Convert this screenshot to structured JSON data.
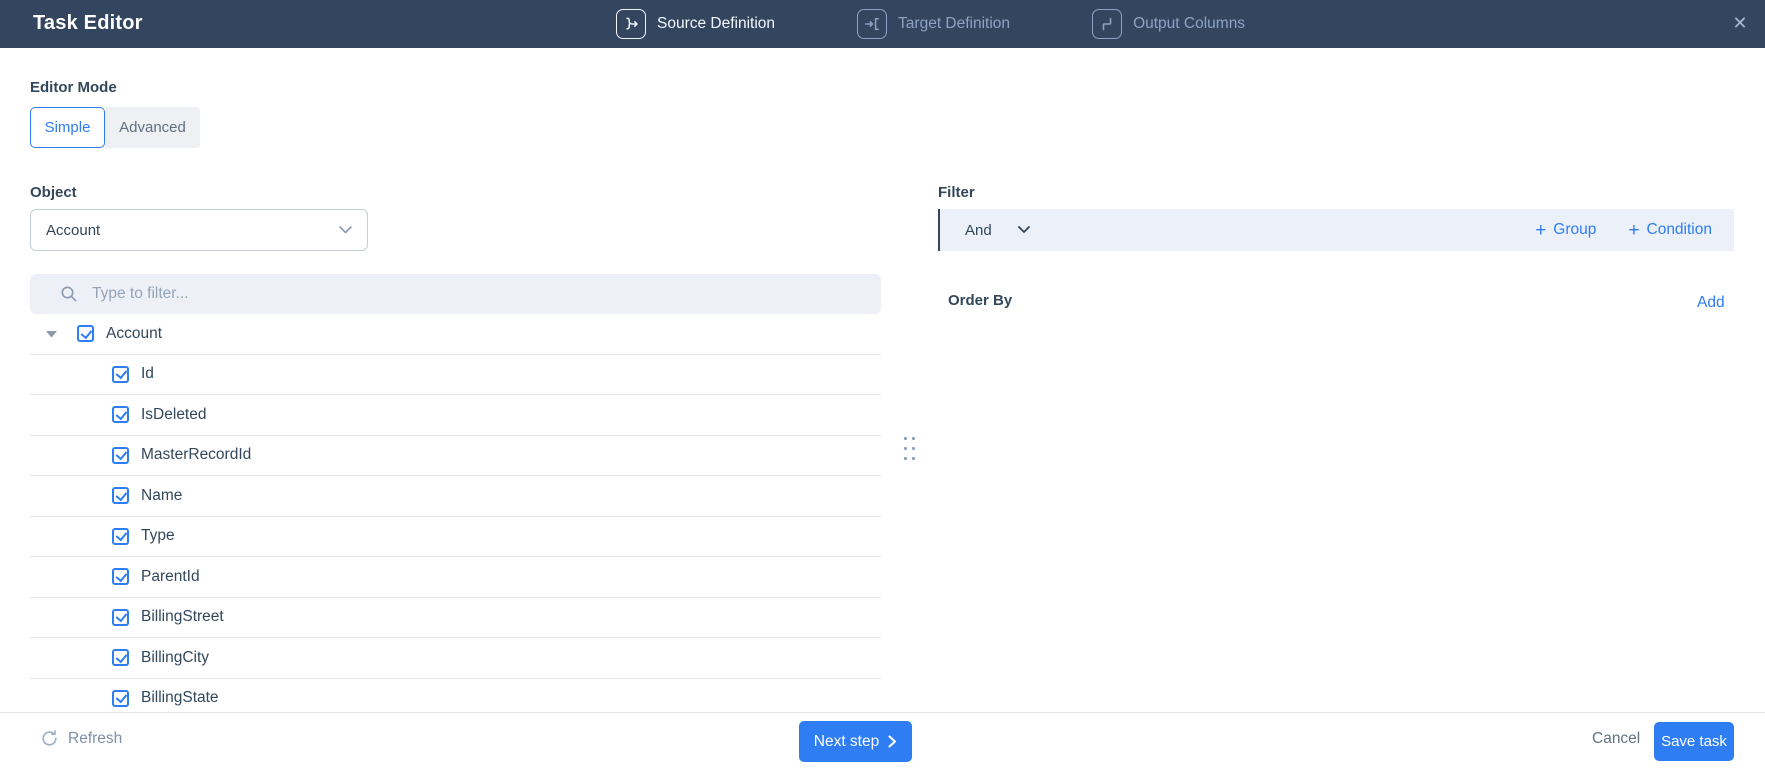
{
  "header": {
    "title": "Task Editor",
    "steps": [
      {
        "label": "Source Definition",
        "icon": "bracket-arrow-icon",
        "active": true
      },
      {
        "label": "Target Definition",
        "icon": "arrow-bracket-icon",
        "active": false
      },
      {
        "label": "Output Columns",
        "icon": "step-connector-icon",
        "active": false
      }
    ],
    "close_glyph": "✕"
  },
  "editor_mode": {
    "label": "Editor Mode",
    "simple": "Simple",
    "advanced": "Advanced",
    "selected": "Simple"
  },
  "source": {
    "object_label": "Object",
    "object_value": "Account",
    "search_placeholder": "Type to filter...",
    "tree_root": "Account",
    "root_checked": true,
    "fields": [
      "Id",
      "IsDeleted",
      "MasterRecordId",
      "Name",
      "Type",
      "ParentId",
      "BillingStreet",
      "BillingCity",
      "BillingState"
    ]
  },
  "filter": {
    "label": "Filter",
    "operator": "And",
    "plus": "+",
    "group": "Group",
    "condition": "Condition"
  },
  "order_by": {
    "label": "Order By",
    "add": "Add"
  },
  "footer": {
    "refresh": "Refresh",
    "next_step": "Next step",
    "cancel": "Cancel",
    "save": "Save task"
  },
  "colors": {
    "header_bg": "#344560",
    "accent_blue": "#2e7df2",
    "text_dark": "#33475b",
    "inactive_step": "#8ca3c5",
    "panel_fill": "#ecf1f9",
    "search_fill": "#edf1f7",
    "row_border": "#e3e8ee"
  }
}
